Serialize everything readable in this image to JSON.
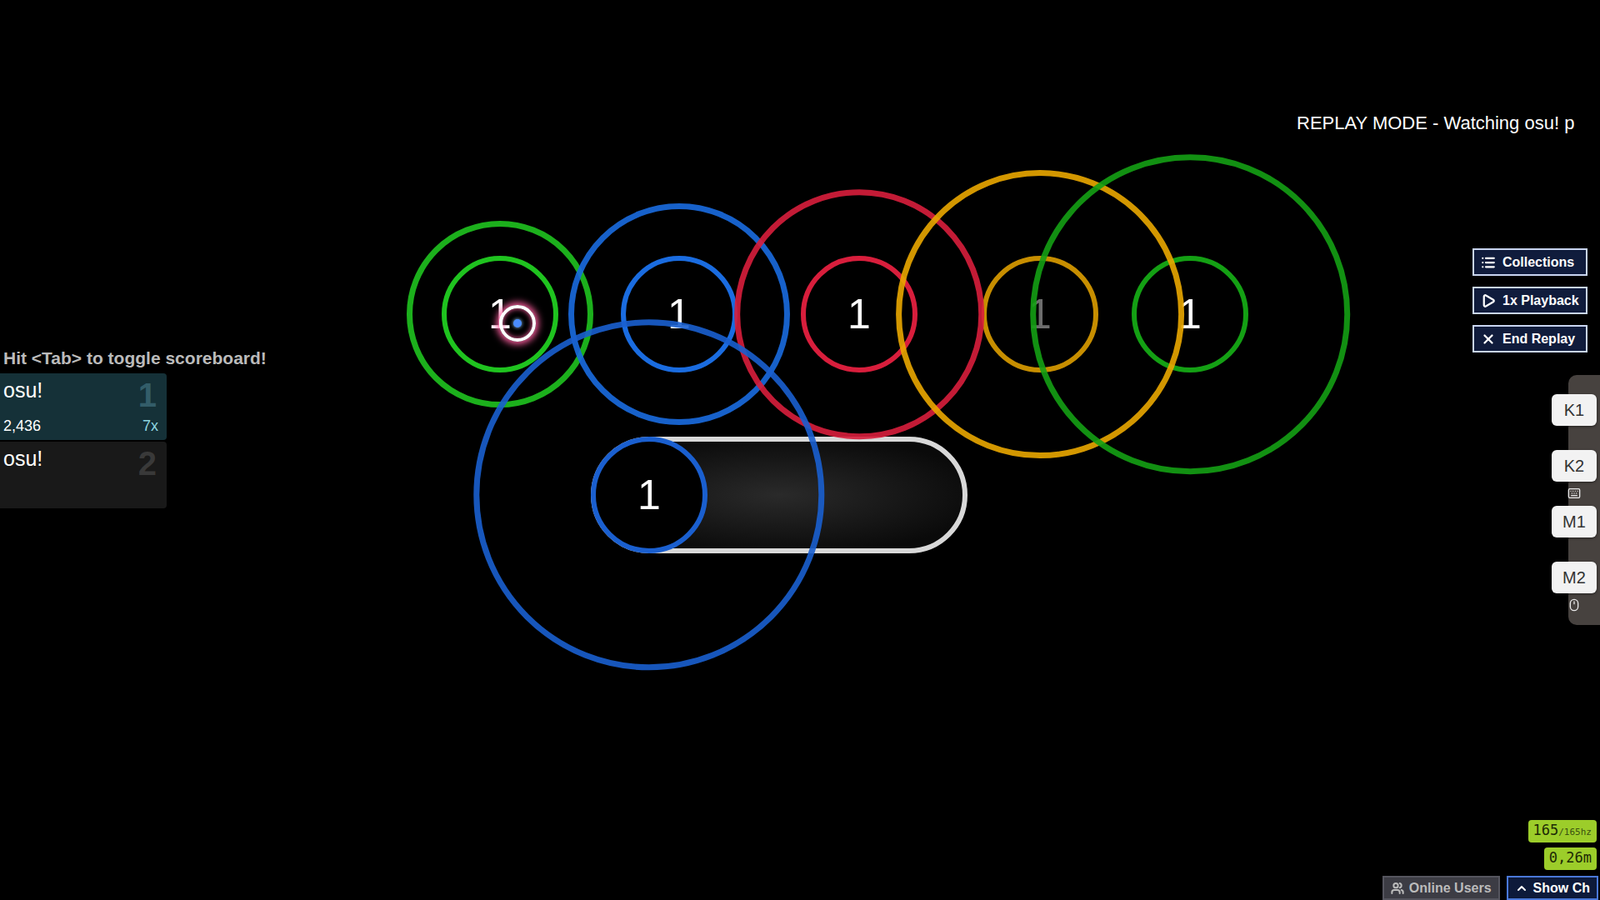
{
  "replay_banner": "REPLAY MODE - Watching osu! p",
  "scoreboard": {
    "hint": "Hit <Tab> to toggle scoreboard!",
    "entries": [
      {
        "rank": "1",
        "name": "osu!",
        "score": "2,436",
        "combo": "7x",
        "selected": true
      },
      {
        "rank": "2",
        "name": "osu!",
        "selected": false
      }
    ]
  },
  "hit_objects": [
    {
      "kind": "circle",
      "number": "1",
      "color": "#1fc31f",
      "level": 0.2,
      "faded": false
    },
    {
      "kind": "circle",
      "number": "1",
      "color": "#1a6ce0",
      "level": 0.3,
      "faded": false
    },
    {
      "kind": "circle",
      "number": "1",
      "color": "#d81e3c",
      "level": 0.38,
      "faded": false
    },
    {
      "kind": "circle",
      "number": "1",
      "color": "#eaa700",
      "level": 0.49,
      "faded": true
    },
    {
      "kind": "circle",
      "number": "1",
      "color": "#14a014",
      "level": 0.58,
      "faded": false
    },
    {
      "kind": "slider",
      "number": "1",
      "color": "#1a5fcf",
      "level": 0.67,
      "faded": false
    }
  ],
  "replay_buttons": [
    {
      "label": "Collections"
    },
    {
      "label": "1x Playback"
    },
    {
      "label": "End Replay"
    }
  ],
  "keys": [
    {
      "label": "K1",
      "pressed": false
    },
    {
      "label": "K2",
      "pressed": false
    },
    {
      "label": "M1",
      "pressed": false
    },
    {
      "label": "M2",
      "pressed": false
    }
  ],
  "performance": {
    "fps": "165",
    "refresh": "/165hz",
    "latency": "0,26m"
  },
  "bottom_bar": [
    {
      "label": "Online Users"
    },
    {
      "label": "Show Ch"
    }
  ]
}
